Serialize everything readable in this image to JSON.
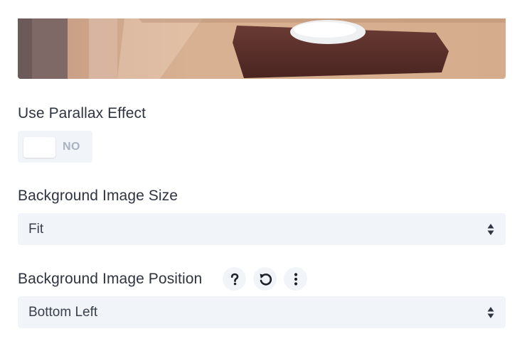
{
  "parallax": {
    "label": "Use Parallax Effect",
    "state": "NO"
  },
  "bg_size": {
    "label": "Background Image Size",
    "value": "Fit"
  },
  "bg_position": {
    "label": "Background Image Position",
    "value": "Bottom Left"
  },
  "icons": {
    "help": "help-icon",
    "reset": "reset-icon",
    "more": "more-options-icon",
    "select_arrows": "select-arrows-icon"
  },
  "colors": {
    "field_bg": "#f1f4f8",
    "label_text": "#2e3440",
    "muted_text": "#aab3c2"
  }
}
